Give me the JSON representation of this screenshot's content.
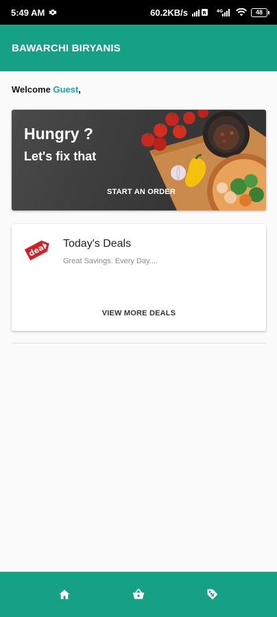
{
  "status_bar": {
    "time": "5:49 AM",
    "net_speed": "60.2KB/s",
    "battery": "48",
    "icons": [
      "settings-icon",
      "signal-icon",
      "wifi-icon",
      "battery-icon"
    ]
  },
  "app_bar": {
    "title": "BAWARCHI BIRYANIS"
  },
  "welcome": {
    "prefix": "Welcome ",
    "name": "Guest",
    "suffix": ","
  },
  "hero": {
    "title": "Hungry ?",
    "subtitle": "Let's fix that",
    "cta": "START AN ORDER"
  },
  "deals": {
    "icon_text": "deal",
    "title": "Today's Deals",
    "subtitle": "Great Savings. Every Day....",
    "link": "VIEW MORE DEALS"
  },
  "bottom_nav": {
    "items": [
      "home-icon",
      "basket-icon",
      "tag-icon"
    ]
  },
  "colors": {
    "primary": "#16a085",
    "accent": "#17a2b8"
  }
}
